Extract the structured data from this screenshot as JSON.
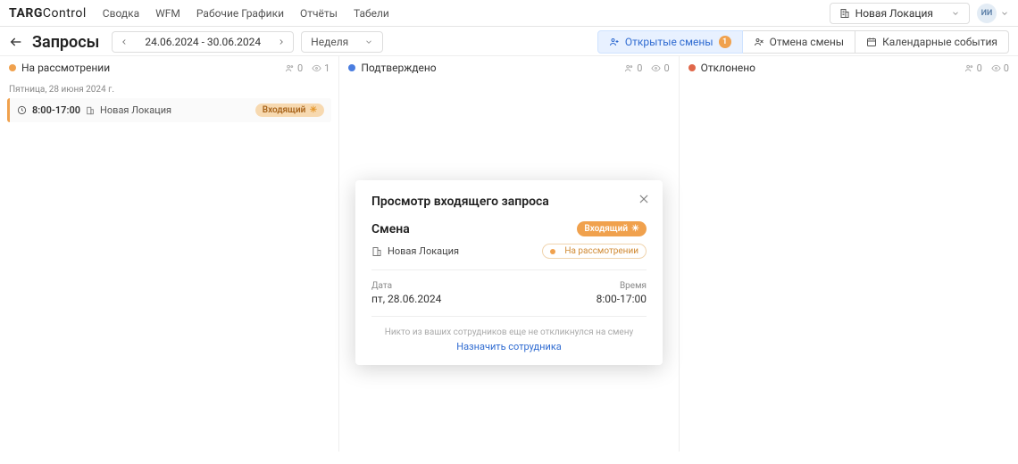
{
  "brand": {
    "strong": "TARG",
    "thin": "Control"
  },
  "nav": {
    "items": [
      "Сводка",
      "WFM",
      "Рабочие Графики",
      "Отчёты",
      "Табели"
    ]
  },
  "location_picker": {
    "label": "Новая Локация"
  },
  "user": {
    "initials": "ИИ"
  },
  "page": {
    "title": "Запросы",
    "date_range": "24.06.2024 - 30.06.2024",
    "period_label": "Неделя"
  },
  "toolbar": {
    "open_shifts": "Открытые смены",
    "open_shifts_count": "1",
    "cancel_shift": "Отмена смены",
    "calendar_events": "Календарные события"
  },
  "columns": {
    "pending": {
      "title": "На рассмотрении",
      "stat_people": "0",
      "stat_eye": "1"
    },
    "approved": {
      "title": "Подтверждено",
      "stat_people": "0",
      "stat_eye": "0"
    },
    "rejected": {
      "title": "Отклонено",
      "stat_people": "0",
      "stat_eye": "0"
    }
  },
  "day_group": {
    "label": "Пятница, 28 июня 2024 г."
  },
  "card": {
    "time": "8:00-17:00",
    "location": "Новая Локация",
    "badge": "Входящий",
    "badge_icon_label": "☀"
  },
  "modal": {
    "title": "Просмотр входящего запроса",
    "section": "Смена",
    "incoming_pill": "Входящий",
    "location": "Новая Локация",
    "status": "На рассмотрении",
    "date_label": "Дата",
    "date_value": "пт, 28.06.2024",
    "time_label": "Время",
    "time_value": "8:00-17:00",
    "empty_text": "Никто из ваших сотрудников еще не откликнулся на смену",
    "assign_link": "Назначить сотрудника"
  }
}
